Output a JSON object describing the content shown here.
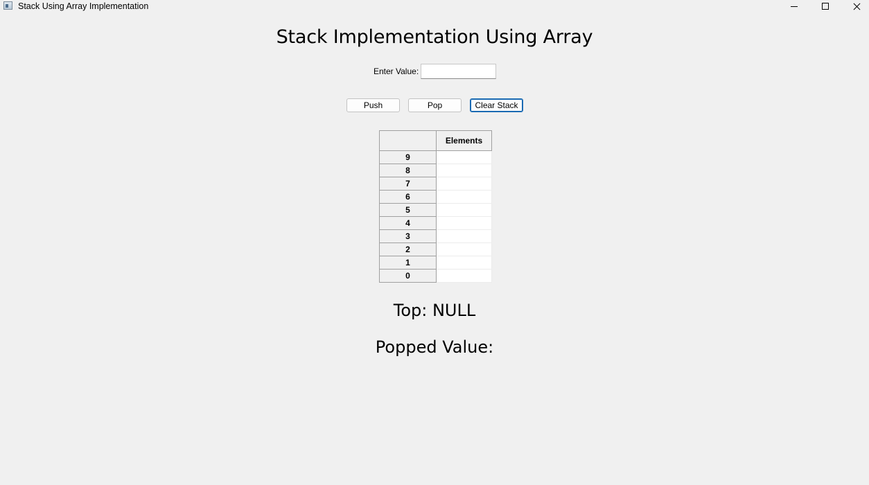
{
  "window": {
    "title": "Stack Using Array Implementation"
  },
  "heading": "Stack Implementation Using Array",
  "input": {
    "label": "Enter Value:",
    "value": "",
    "placeholder": ""
  },
  "buttons": {
    "push": "Push",
    "pop": "Pop",
    "clear": "Clear Stack"
  },
  "table": {
    "header_index": "",
    "header_elements": "Elements",
    "rows": [
      {
        "index": "9",
        "value": ""
      },
      {
        "index": "8",
        "value": ""
      },
      {
        "index": "7",
        "value": ""
      },
      {
        "index": "6",
        "value": ""
      },
      {
        "index": "5",
        "value": ""
      },
      {
        "index": "4",
        "value": ""
      },
      {
        "index": "3",
        "value": ""
      },
      {
        "index": "2",
        "value": ""
      },
      {
        "index": "1",
        "value": ""
      },
      {
        "index": "0",
        "value": ""
      }
    ]
  },
  "status": {
    "top": "Top: NULL",
    "popped": "Popped Value:"
  },
  "icons": {
    "app": "app-window-icon",
    "minimize": "minimize-icon",
    "maximize": "maximize-icon",
    "close": "close-icon"
  },
  "colors": {
    "background": "#f0f0f0",
    "focus_border": "#1a6ab3"
  }
}
